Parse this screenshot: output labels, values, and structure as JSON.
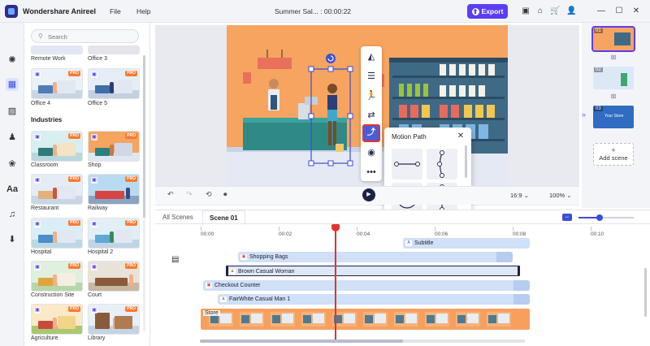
{
  "app": {
    "name": "Wondershare Anireel",
    "doc_title": "Summer Sal... : 00:00:22"
  },
  "menu": {
    "file": "File",
    "help": "Help"
  },
  "toolbar": {
    "export_label": "Export"
  },
  "library": {
    "search_placeholder": "Search",
    "top_tiles": [
      {
        "label": "Remote Work",
        "pro": false
      },
      {
        "label": "Office 3",
        "pro": false
      },
      {
        "label": "Office 4",
        "pro": true
      },
      {
        "label": "Office 5",
        "pro": true
      }
    ],
    "section_title": "Industries",
    "tiles": [
      {
        "label": "Classroom",
        "pro": true
      },
      {
        "label": "Shop",
        "pro": true
      },
      {
        "label": "Restaurant",
        "pro": true
      },
      {
        "label": "Railway",
        "pro": true
      },
      {
        "label": "Hospital",
        "pro": true
      },
      {
        "label": "Hospital 2",
        "pro": true
      },
      {
        "label": "Construction Site",
        "pro": true
      },
      {
        "label": "Court",
        "pro": true
      },
      {
        "label": "Agriculture",
        "pro": true
      },
      {
        "label": "Library",
        "pro": true
      }
    ],
    "pro_badge": "PRO"
  },
  "canvas": {
    "ratio": "16:9",
    "zoom": "100%"
  },
  "motion_popup": {
    "title": "Motion Path",
    "close": "✕"
  },
  "scenes": {
    "items": [
      {
        "num": "01"
      },
      {
        "num": "02"
      },
      {
        "num": "03",
        "caption": "Your Store"
      }
    ],
    "add_label": "Add scene",
    "add_plus": "+"
  },
  "timeline": {
    "tab_all": "All Scenes",
    "tab_scene": "Scene 01",
    "ticks": [
      "00:00",
      "00:02",
      "00:04",
      "00:06",
      "00:08",
      "00:10"
    ],
    "tracks": {
      "subtitle": "Subtitle",
      "shopping_bags": "Shopping Bags",
      "brown_woman": "Brown Casual Woman",
      "checkout": "Checkout Counter",
      "fairwhite": "FairWhite Casual Man 1",
      "store": "Store"
    }
  },
  "colors": {
    "accent": "#5b3df5",
    "playhead": "#e0342c",
    "track": "#cfe0f7",
    "scene_bg": "#f6a45f"
  }
}
